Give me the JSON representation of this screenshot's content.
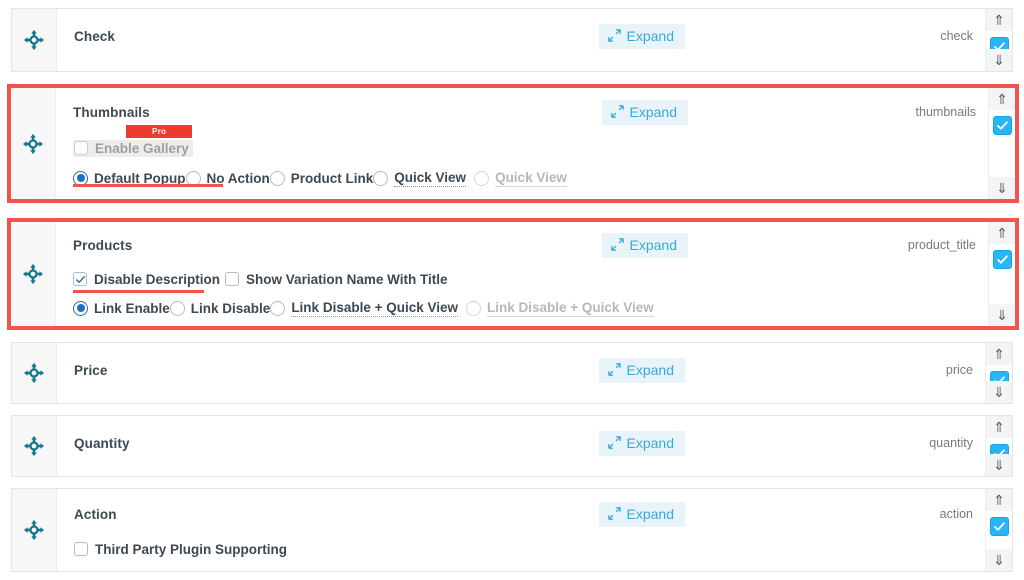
{
  "page": {
    "accent_blue": "#39a8dd",
    "highlight_red": "#f4524d",
    "checkbox_blue": "#29b6f6",
    "pro_badge_red": "#ef3b2d"
  },
  "common": {
    "expand_label": "Expand",
    "move_icon": "move-icon",
    "expand_icon": "expand-arrows-icon",
    "arrow_up": "⇑",
    "arrow_down": "⇓",
    "pro_badge": "Pro"
  },
  "cards": [
    {
      "id": "check",
      "title": "Check",
      "slug": "check",
      "highlighted": false,
      "enabled": true,
      "expand_label": "Expand",
      "options": []
    },
    {
      "id": "thumbnails",
      "title": "Thumbnails",
      "slug": "thumbnails",
      "highlighted": true,
      "enabled": true,
      "expand_label": "Expand",
      "checkbox_row": {
        "label": "Enable Gallery",
        "checked": false,
        "disabled": true,
        "pro_badge": "Pro"
      },
      "radio_row": [
        {
          "label": "Default Popup",
          "checked": true,
          "disabled": false
        },
        {
          "label": "No Action",
          "checked": false,
          "disabled": false
        },
        {
          "label": "Product Link",
          "checked": false,
          "disabled": false
        },
        {
          "label": "Quick View",
          "checked": false,
          "disabled": false
        },
        {
          "label": "Quick View",
          "checked": false,
          "disabled": true
        }
      ]
    },
    {
      "id": "products",
      "title": "Products",
      "slug": "product_title",
      "highlighted": true,
      "enabled": true,
      "expand_label": "Expand",
      "checkbox_row_multi": [
        {
          "label": "Disable Description",
          "checked": true,
          "disabled": false
        },
        {
          "label": "Show Variation Name With Title",
          "checked": false,
          "disabled": false
        }
      ],
      "radio_row": [
        {
          "label": "Link Enable",
          "checked": true,
          "disabled": false
        },
        {
          "label": "Link Disable",
          "checked": false,
          "disabled": false
        },
        {
          "label": "Link Disable + Quick View",
          "checked": false,
          "disabled": false
        },
        {
          "label": "Link Disable + Quick View",
          "checked": false,
          "disabled": true
        }
      ]
    },
    {
      "id": "price",
      "title": "Price",
      "slug": "price",
      "highlighted": false,
      "enabled": true,
      "expand_label": "Expand",
      "options": []
    },
    {
      "id": "quantity",
      "title": "Quantity",
      "slug": "quantity",
      "highlighted": false,
      "enabled": true,
      "expand_label": "Expand",
      "options": []
    },
    {
      "id": "action",
      "title": "Action",
      "slug": "action",
      "highlighted": false,
      "enabled": true,
      "expand_label": "Expand",
      "checkbox_row": {
        "label": "Third Party Plugin Supporting",
        "checked": false,
        "disabled": false
      }
    }
  ]
}
